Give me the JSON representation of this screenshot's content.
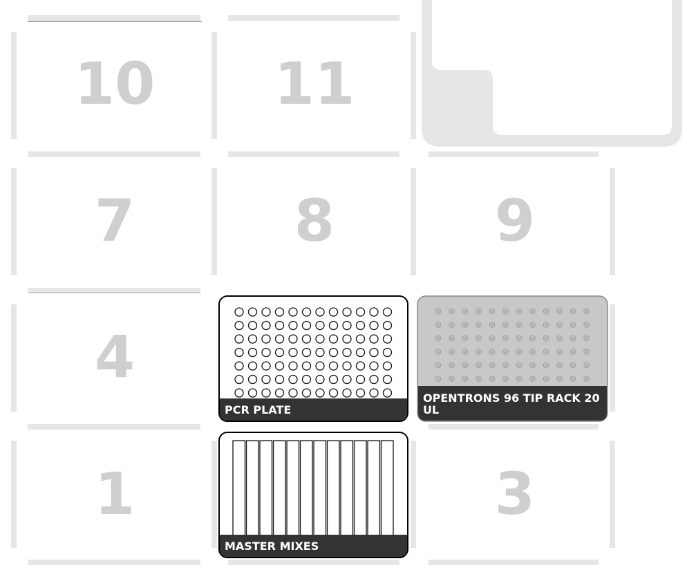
{
  "deck": {
    "slots": [
      {
        "id": "slot-10",
        "label": "10"
      },
      {
        "id": "slot-11",
        "label": "11"
      },
      {
        "id": "slot-7",
        "label": "7"
      },
      {
        "id": "slot-8",
        "label": "8"
      },
      {
        "id": "slot-9",
        "label": "9"
      },
      {
        "id": "slot-4",
        "label": "4"
      },
      {
        "id": "slot-1",
        "label": "1"
      },
      {
        "id": "slot-3",
        "label": "3"
      }
    ]
  },
  "labware": {
    "pcr_plate": {
      "name": "PCR PLATE",
      "rows": 8,
      "columns": 12
    },
    "tip_rack": {
      "name_line1": "OPENTRONS 96 TIP RACK 20",
      "name_line2": "UL",
      "rows": 8,
      "columns": 12
    },
    "master_mixes": {
      "name": "MASTER MIXES",
      "columns": 12
    }
  }
}
